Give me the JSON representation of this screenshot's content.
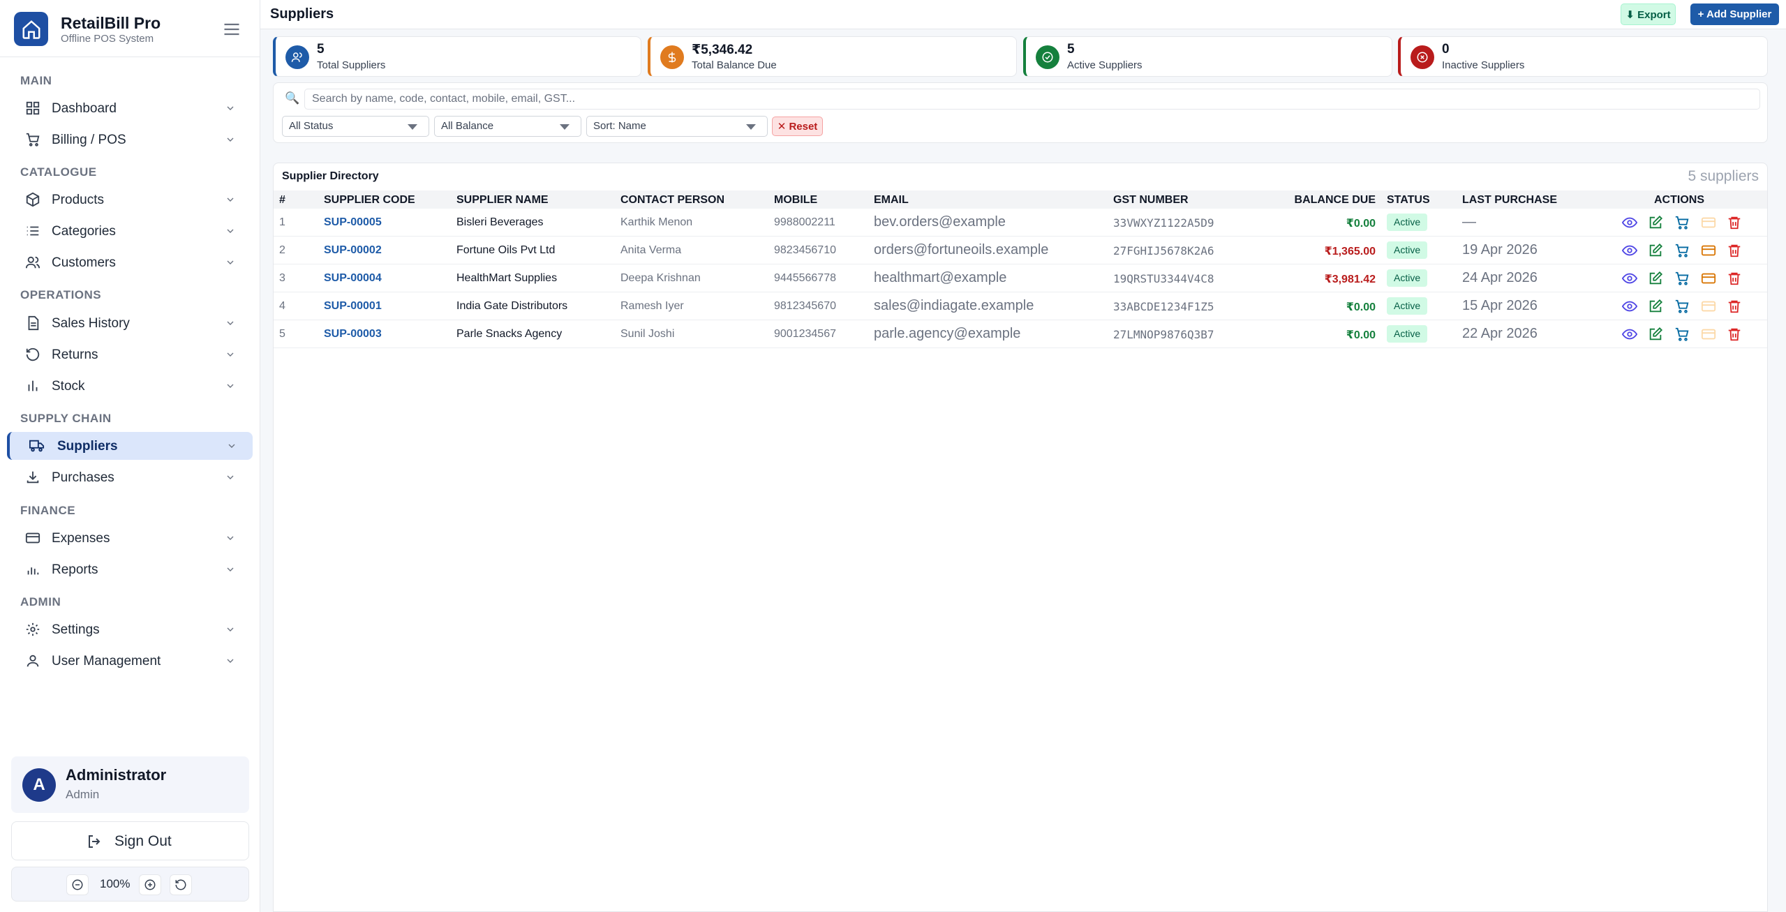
{
  "brand": {
    "title": "RetailBill Pro",
    "subtitle": "Offline POS System"
  },
  "nav": {
    "sections": {
      "main": "MAIN",
      "catalogue": "CATALOGUE",
      "operations": "OPERATIONS",
      "supply": "SUPPLY CHAIN",
      "finance": "FINANCE",
      "admin": "ADMIN"
    },
    "items": {
      "dashboard": "Dashboard",
      "billing": "Billing / POS",
      "products": "Products",
      "categories": "Categories",
      "customers": "Customers",
      "sales": "Sales History",
      "returns": "Returns",
      "stock": "Stock",
      "suppliers": "Suppliers",
      "purchases": "Purchases",
      "expenses": "Expenses",
      "reports": "Reports",
      "settings": "Settings",
      "users": "User Management"
    }
  },
  "user": {
    "initial": "A",
    "name": "Administrator",
    "role": "Admin"
  },
  "signout": "Sign Out",
  "zoom": "100%",
  "header": {
    "title": "Suppliers",
    "export": "⬇ Export",
    "add": "+ Add Supplier"
  },
  "stats": [
    {
      "value": "5",
      "label": "Total Suppliers"
    },
    {
      "value": "₹5,346.42",
      "label": "Total Balance Due"
    },
    {
      "value": "5",
      "label": "Active Suppliers"
    },
    {
      "value": "0",
      "label": "Inactive Suppliers"
    }
  ],
  "filters": {
    "search_placeholder": "Search by name, code, contact, mobile, email, GST...",
    "status": "All Status",
    "balance": "All Balance",
    "sort": "Sort: Name",
    "reset": "✕ Reset"
  },
  "table": {
    "title": "Supplier Directory",
    "count": "5 suppliers",
    "headers": {
      "num": "#",
      "code": "SUPPLIER CODE",
      "name": "SUPPLIER NAME",
      "contact": "CONTACT PERSON",
      "mobile": "MOBILE",
      "email": "EMAIL",
      "gst": "GST NUMBER",
      "balance": "BALANCE DUE",
      "status": "STATUS",
      "last": "LAST PURCHASE",
      "actions": "ACTIONS"
    },
    "rows": [
      {
        "num": "1",
        "code": "SUP-00005",
        "name": "Bisleri Beverages",
        "contact": "Karthik Menon",
        "mobile": "9988002211",
        "email": "bev.orders@example",
        "gst": "33VWXYZ1122A5D9",
        "balance": "₹0.00",
        "status": "Active",
        "last": "—"
      },
      {
        "num": "2",
        "code": "SUP-00002",
        "name": "Fortune Oils Pvt Ltd",
        "contact": "Anita Verma",
        "mobile": "9823456710",
        "email": "orders@fortuneoils.example",
        "gst": "27FGHIJ5678K2A6",
        "balance": "₹1,365.00",
        "status": "Active",
        "last": "19 Apr 2026"
      },
      {
        "num": "3",
        "code": "SUP-00004",
        "name": "HealthMart Supplies",
        "contact": "Deepa Krishnan",
        "mobile": "9445566778",
        "email": "healthmart@example",
        "gst": "19QRSTU3344V4C8",
        "balance": "₹3,981.42",
        "status": "Active",
        "last": "24 Apr 2026"
      },
      {
        "num": "4",
        "code": "SUP-00001",
        "name": "India Gate Distributors",
        "contact": "Ramesh Iyer",
        "mobile": "9812345670",
        "email": "sales@indiagate.example",
        "gst": "33ABCDE1234F1Z5",
        "balance": "₹0.00",
        "status": "Active",
        "last": "15 Apr 2026"
      },
      {
        "num": "5",
        "code": "SUP-00003",
        "name": "Parle Snacks Agency",
        "contact": "Sunil Joshi",
        "mobile": "9001234567",
        "email": "parle.agency@example",
        "gst": "27LMNOP9876Q3B7",
        "balance": "₹0.00",
        "status": "Active",
        "last": "22 Apr 2026"
      }
    ]
  },
  "colors": {
    "primary": "#1e5ba8",
    "balance_due": "#b91c1c",
    "balance_zero": "#15803d"
  }
}
